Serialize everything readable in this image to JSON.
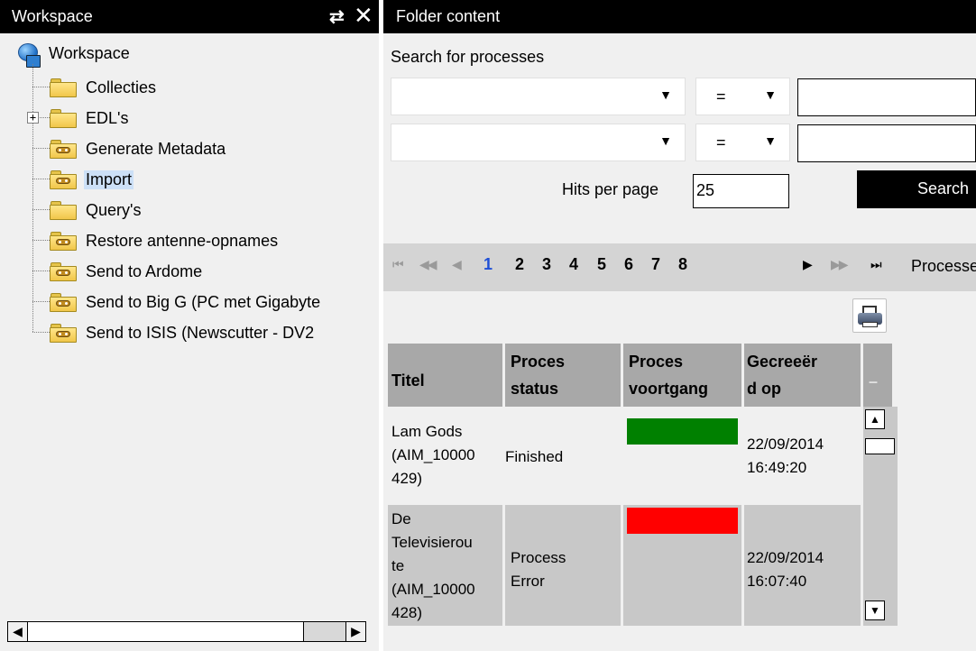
{
  "workspace": {
    "title": "Workspace",
    "refresh_glyph": "⇄",
    "close_glyph": "✕",
    "root_label": "Workspace",
    "items": [
      {
        "label": "Collecties",
        "icon": "folder-icon"
      },
      {
        "label": "EDL's",
        "icon": "folder-icon",
        "expander": "+"
      },
      {
        "label": "Generate Metadata",
        "icon": "process-folder-icon"
      },
      {
        "label": "Import",
        "icon": "process-folder-icon",
        "selected": true
      },
      {
        "label": "Query's",
        "icon": "folder-icon"
      },
      {
        "label": "Restore antenne-opnames",
        "icon": "process-folder-icon"
      },
      {
        "label": "Send to Ardome",
        "icon": "process-folder-icon"
      },
      {
        "label": "Send to Big G (PC met Gigabyte",
        "icon": "process-folder-icon"
      },
      {
        "label": "Send to ISIS (Newscutter - DV2",
        "icon": "process-folder-icon"
      }
    ],
    "scroll_left_glyph": "◀",
    "scroll_right_glyph": "▶"
  },
  "folder_content": {
    "title": "Folder content",
    "search_label": "Search for processes",
    "filters": [
      {
        "field": "",
        "operator": "=",
        "value": ""
      },
      {
        "field": "",
        "operator": "=",
        "value": ""
      }
    ],
    "dropdown_glyph": "▼",
    "hits_label": "Hits per page",
    "hits_value": "25",
    "search_button": "Search",
    "pager": {
      "first": "⏮",
      "prev_fast": "◀◀",
      "prev": "◀",
      "pages": [
        "1",
        "2",
        "3",
        "4",
        "5",
        "6",
        "7",
        "8"
      ],
      "current_page": "1",
      "next": "▶",
      "next_fast": "▶▶",
      "last": "⏭",
      "trailing_label": "Processe"
    },
    "table": {
      "columns": [
        {
          "line1": "Titel",
          "line2": ""
        },
        {
          "line1": "Proces",
          "line2": "status"
        },
        {
          "line1": "Proces",
          "line2": "voortgang"
        },
        {
          "line1": "Gecreeër",
          "line2": "d op"
        }
      ],
      "rows": [
        {
          "title_lines": [
            "Lam Gods",
            "(AIM_10000",
            "429)"
          ],
          "status_lines": [
            "Finished"
          ],
          "progress_color": "#008000",
          "created_lines": [
            "22/09/2014",
            "16:49:20"
          ]
        },
        {
          "title_lines": [
            "De",
            "Televisierou",
            "te",
            "(AIM_10000",
            "428)"
          ],
          "status_lines": [
            "Process",
            "Error"
          ],
          "progress_color": "#ff0000",
          "created_lines": [
            "22/09/2014",
            "16:07:40"
          ]
        }
      ],
      "scroll_up_glyph": "▲",
      "scroll_down_glyph": "▼",
      "corner_glyph": "–"
    }
  },
  "colors": {
    "header_bg": "#000000",
    "panel_bg": "#f0f0f0",
    "selection": "#cce0f7",
    "current_page": "#1e4fd6"
  }
}
